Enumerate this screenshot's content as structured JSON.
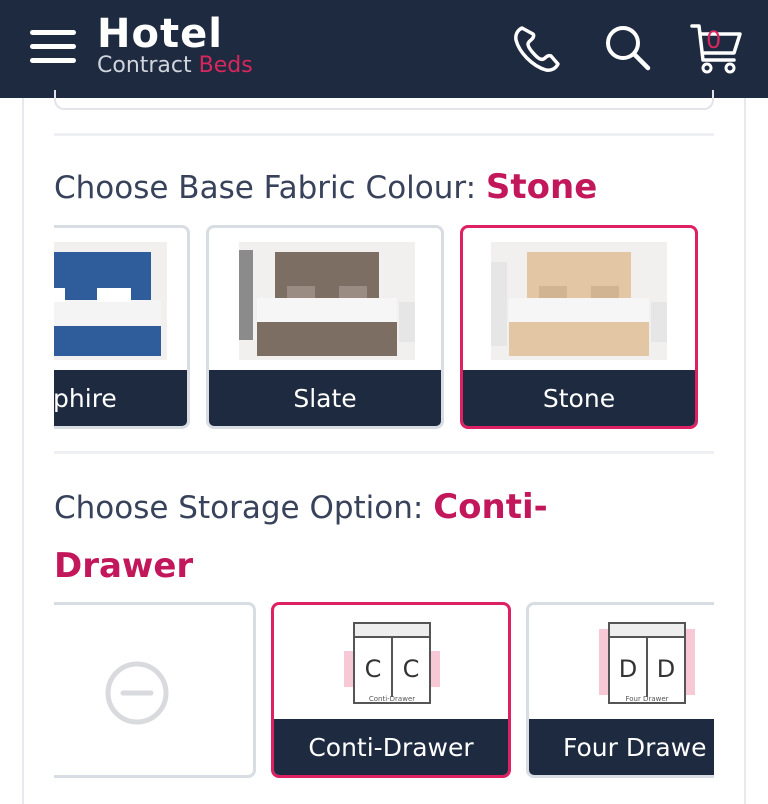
{
  "header": {
    "logo_main": "Hotel",
    "logo_sub_1": "Contract ",
    "logo_sub_2": "Beds",
    "cart_count": "0",
    "icons": [
      "menu-icon",
      "phone-icon",
      "search-icon",
      "cart-icon"
    ]
  },
  "fabric": {
    "title": "Choose Base Fabric Colour: ",
    "selected": "Stone",
    "options": [
      {
        "label": "pphire",
        "color": "#2f5d9c"
      },
      {
        "label": "Slate",
        "color": "#7d6e64"
      },
      {
        "label": "Stone",
        "color": "#e3c6a4"
      }
    ]
  },
  "storage": {
    "title": "Choose Storage Option: ",
    "selected": "Conti-Drawer",
    "options": [
      {
        "label": "",
        "icon": "none-icon"
      },
      {
        "label": "Conti-Drawer",
        "letter": "C",
        "caption": "Conti-Drawer"
      },
      {
        "label": "Four Drawe",
        "letter": "D",
        "caption": "Four Drawer"
      }
    ]
  },
  "colors": {
    "accent": "#de2163",
    "navy": "#1d2a3f"
  }
}
